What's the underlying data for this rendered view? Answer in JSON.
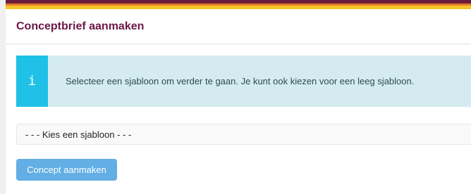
{
  "header": {
    "title": "Conceptbrief aanmaken"
  },
  "alert": {
    "icon": "info-icon",
    "icon_glyph": "i",
    "message": "Selecteer een sjabloon om verder te gaan. Je kunt ook kiezen voor een leeg sjabloon.",
    "accent_color": "#1fc1e6",
    "background_color": "#d4ecf0"
  },
  "template_select": {
    "selected": "- - - Kies een sjabloon - - -"
  },
  "actions": {
    "create_label": "Concept aanmaken",
    "create_color": "#62aee5"
  },
  "brand_colors": [
    "#6b1c3a",
    "#e37c2a",
    "#f6c426"
  ]
}
